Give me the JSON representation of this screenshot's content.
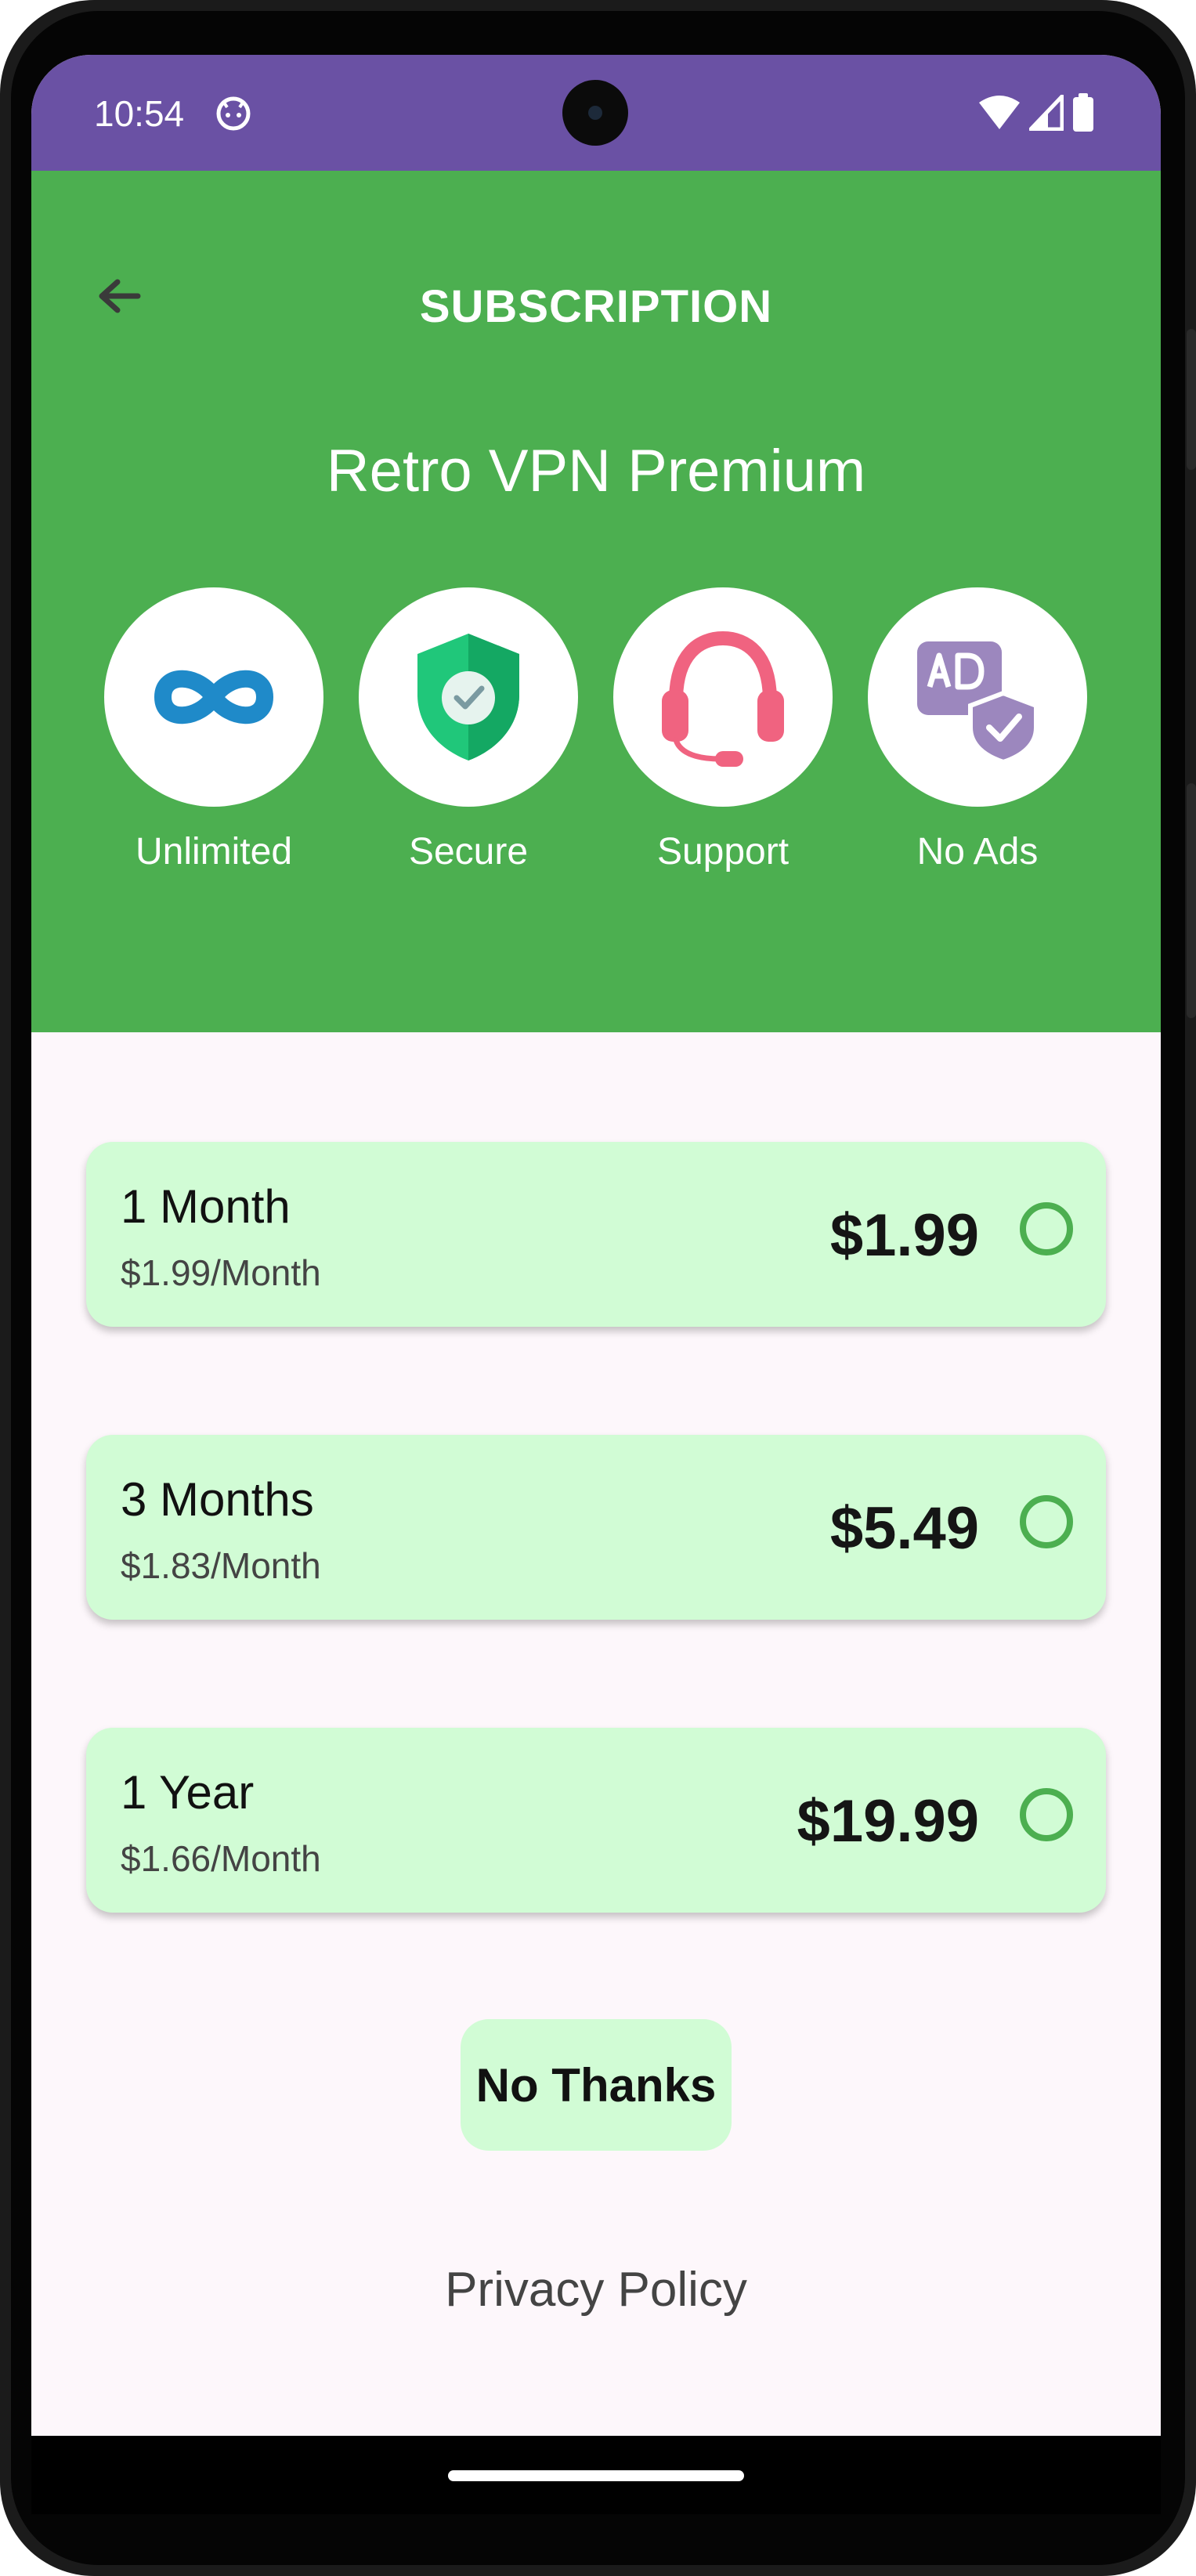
{
  "status_bar": {
    "time": "10:54",
    "app_icon": "android-face-icon",
    "icons": [
      "wifi-icon",
      "signal-icon",
      "battery-icon"
    ]
  },
  "header": {
    "back_icon": "arrow-back-icon",
    "title": "SUBSCRIPTION",
    "product_title": "Retro VPN Premium",
    "background_color": "#4caf50"
  },
  "features": [
    {
      "label": "Unlimited",
      "icon": "infinity-icon"
    },
    {
      "label": "Secure",
      "icon": "shield-check-icon"
    },
    {
      "label": "Support",
      "icon": "headset-icon"
    },
    {
      "label": "No Ads",
      "icon": "no-ads-shield-icon"
    }
  ],
  "plans": [
    {
      "name": "1 Month",
      "per_month": "$1.99/Month",
      "price": "$1.99",
      "selected": false
    },
    {
      "name": "3 Months",
      "per_month": "$1.83/Month",
      "price": "$5.49",
      "selected": false
    },
    {
      "name": "1 Year",
      "per_month": "$1.66/Month",
      "price": "$19.99",
      "selected": false
    }
  ],
  "actions": {
    "no_thanks": "No Thanks",
    "privacy_policy": "Privacy Policy"
  },
  "colors": {
    "status_bar": "#6a51a4",
    "accent_green": "#4caf50",
    "plan_card": "#d1fcd5",
    "screen_background": "#fdf7fb"
  }
}
